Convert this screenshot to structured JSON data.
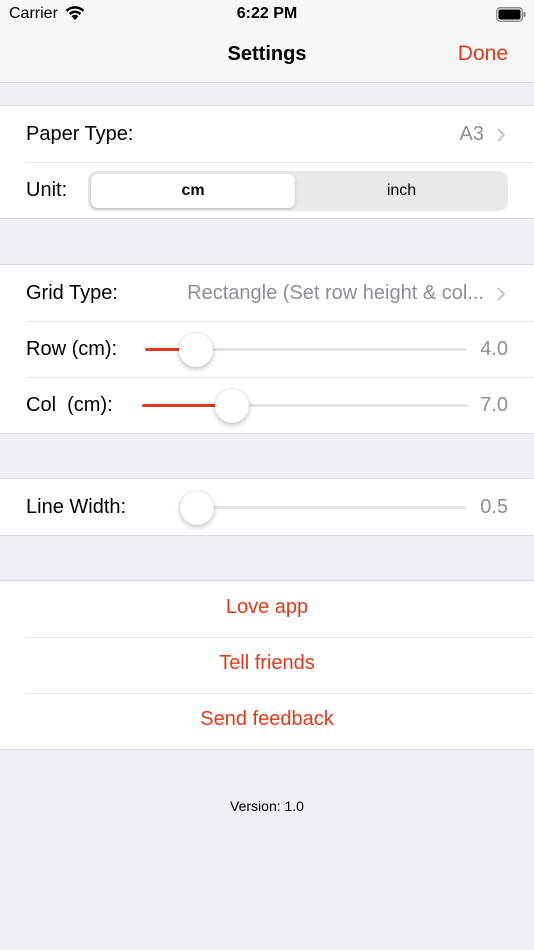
{
  "status_bar": {
    "carrier": "Carrier",
    "time": "6:22 PM"
  },
  "nav": {
    "title": "Settings",
    "done_label": "Done"
  },
  "paper": {
    "label": "Paper Type:",
    "value": "A3"
  },
  "unit": {
    "label": "Unit:",
    "options": [
      "cm",
      "inch"
    ],
    "selected": "cm"
  },
  "grid": {
    "label": "Grid Type:",
    "value": "Rectangle (Set row height & col..."
  },
  "row_slider": {
    "label": "Row (cm):",
    "value": "4.0",
    "min": 0,
    "max": 40,
    "level": 0.12
  },
  "col_slider": {
    "label": "Col  (cm):",
    "value": "7.0",
    "min": 0,
    "max": 40,
    "level": 0.25
  },
  "line_width": {
    "label": "Line Width:",
    "value": "0.5",
    "level": 0.0
  },
  "actions": {
    "love": "Love app",
    "tell": "Tell friends",
    "feedback": "Send feedback"
  },
  "version": "Version: 1.0",
  "colors": {
    "accent": "#e0391c",
    "background": "#efeff4",
    "secondary_text": "#8e8e93"
  }
}
